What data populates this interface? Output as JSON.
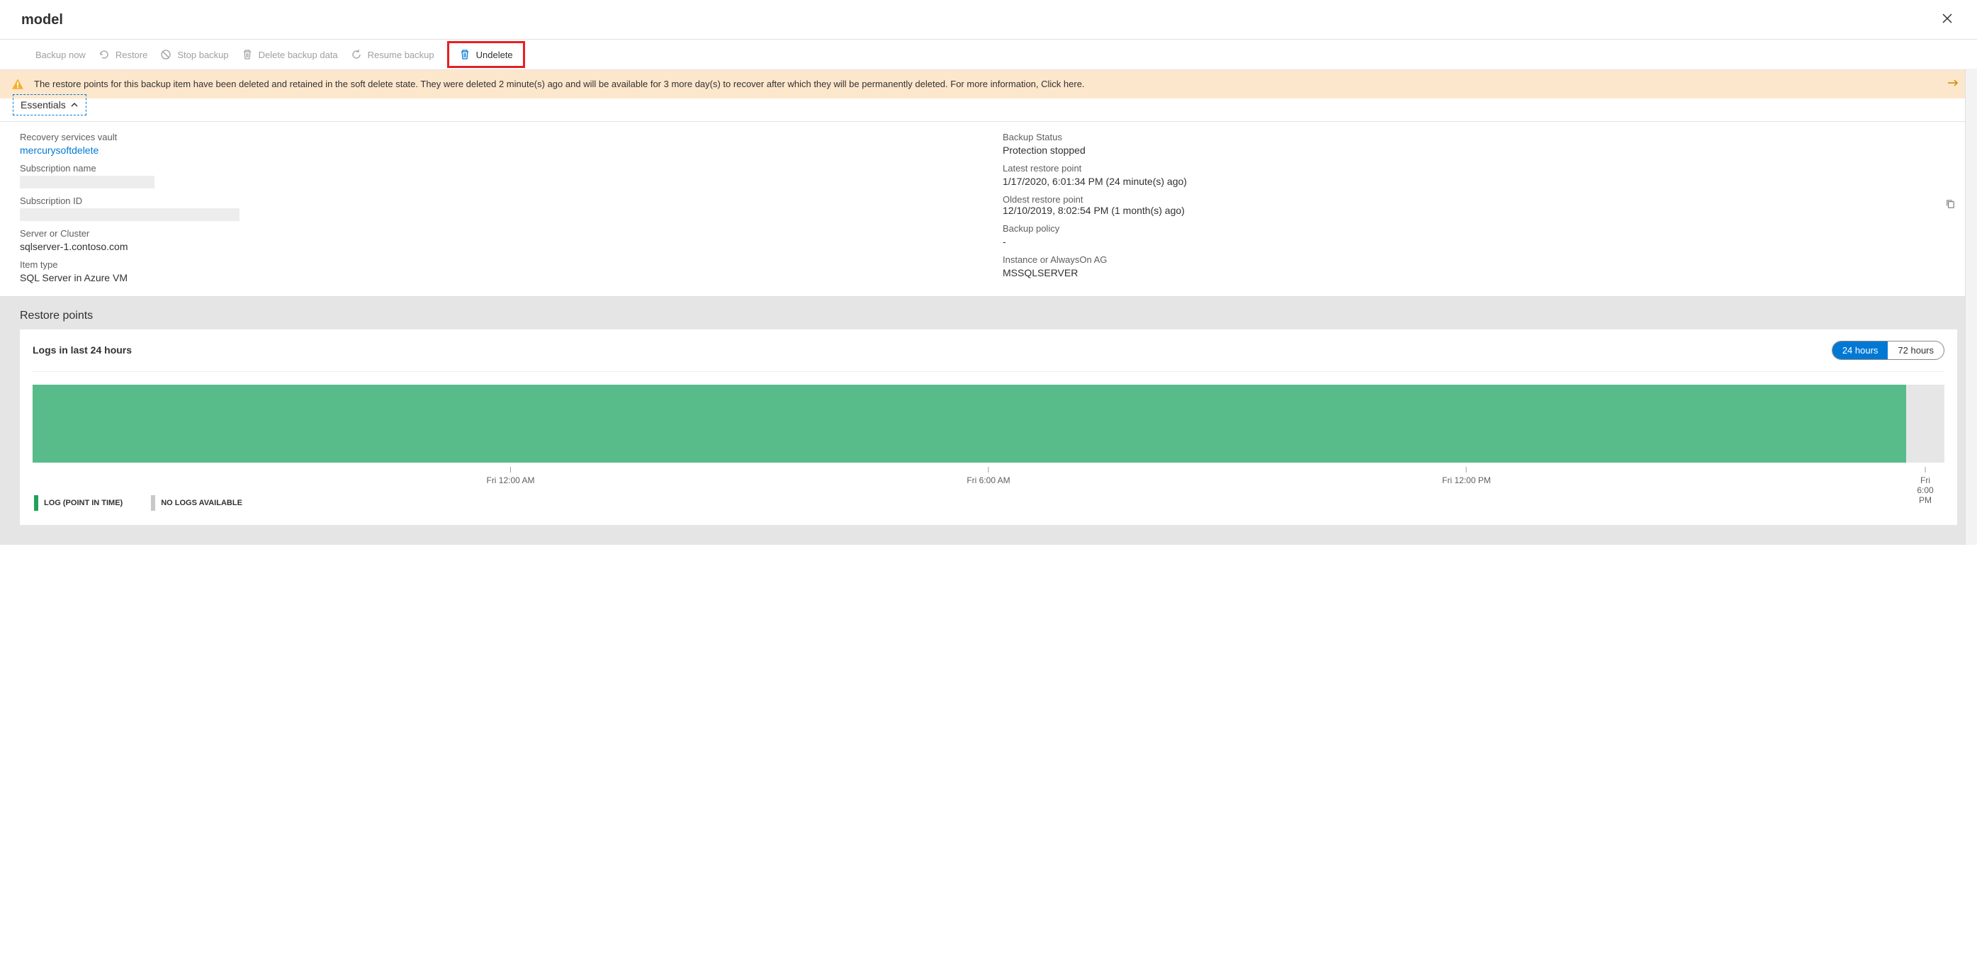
{
  "header": {
    "title": "model"
  },
  "toolbar": {
    "backup_now": "Backup now",
    "restore": "Restore",
    "stop_backup": "Stop backup",
    "delete_backup_data": "Delete backup data",
    "resume_backup": "Resume backup",
    "undelete": "Undelete"
  },
  "banner": {
    "text": "The restore points for this backup item have been deleted and retained in the soft delete state. They were deleted 2 minute(s) ago and will be available for 3 more day(s) to recover after which they will be permanently deleted. For more information, Click here."
  },
  "essentials": {
    "label": "Essentials",
    "left": {
      "recovery_vault_label": "Recovery services vault",
      "recovery_vault_value": "mercurysoftdelete",
      "subscription_name_label": "Subscription name",
      "subscription_id_label": "Subscription ID",
      "server_label": "Server or Cluster",
      "server_value": "sqlserver-1.contoso.com",
      "item_type_label": "Item type",
      "item_type_value": "SQL Server in Azure VM"
    },
    "right": {
      "backup_status_label": "Backup Status",
      "backup_status_value": "Protection stopped",
      "latest_restore_label": "Latest restore point",
      "latest_restore_value": "1/17/2020, 6:01:34 PM (24 minute(s) ago)",
      "oldest_restore_label": "Oldest restore point",
      "oldest_restore_value": "12/10/2019, 8:02:54 PM (1 month(s) ago)",
      "backup_policy_label": "Backup policy",
      "backup_policy_value": "-",
      "instance_label": "Instance or AlwaysOn AG",
      "instance_value": "MSSQLSERVER"
    }
  },
  "restore_points": {
    "section_title": "Restore points",
    "card_title": "Logs in last 24 hours",
    "toggle": {
      "opt1": "24 hours",
      "opt2": "72 hours",
      "active": "24 hours"
    },
    "legend": {
      "log": "LOG (POINT IN TIME)",
      "none": "NO LOGS AVAILABLE"
    },
    "ticks": [
      "Fri 12:00 AM",
      "Fri 6:00 AM",
      "Fri 12:00 PM",
      "Fri 6:00 PM"
    ]
  },
  "chart_data": {
    "type": "bar",
    "title": "Logs in last 24 hours",
    "xlabel": "",
    "ylabel": "",
    "categories": [
      "Fri 12:00 AM",
      "Fri 6:00 AM",
      "Fri 12:00 PM",
      "Fri 6:00 PM"
    ],
    "series": [
      {
        "name": "LOG (POINT IN TIME)",
        "coverage_percent": 98
      },
      {
        "name": "NO LOGS AVAILABLE",
        "coverage_percent": 2
      }
    ],
    "xrange_hours": 24
  }
}
